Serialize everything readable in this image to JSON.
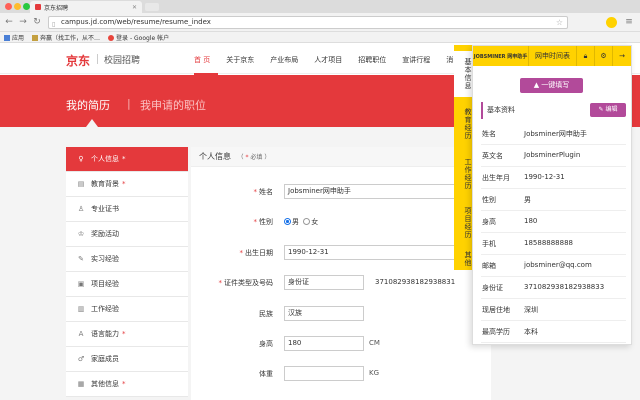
{
  "browser": {
    "tab_title": "京东招聘",
    "url": "campus.jd.com/web/resume/resume_index",
    "bookmarks": [
      "应用",
      "奔赢（找工作，从不…",
      "登录 - Google 帐户"
    ]
  },
  "header": {
    "logo": "京东",
    "sub": "校园招聘",
    "nav": [
      "首 页",
      "关于京东",
      "产业布局",
      "人才项目",
      "招聘职位",
      "宣讲行程",
      "消"
    ]
  },
  "banner": {
    "title": "我的简历",
    "separator": "|",
    "sub": "我申请的职位"
  },
  "sidemenu": [
    {
      "label": "个人信息",
      "icon": "person-icon",
      "glyph": "♀",
      "required": true,
      "active": true
    },
    {
      "label": "教育背景",
      "icon": "education-icon",
      "glyph": "▤",
      "required": true
    },
    {
      "label": "专业证书",
      "icon": "certificate-icon",
      "glyph": "♙",
      "required": false
    },
    {
      "label": "奖励活动",
      "icon": "award-icon",
      "glyph": "♔",
      "required": false
    },
    {
      "label": "实习经验",
      "icon": "internship-icon",
      "glyph": "✎",
      "required": false
    },
    {
      "label": "项目经验",
      "icon": "project-icon",
      "glyph": "▣",
      "required": false
    },
    {
      "label": "工作经验",
      "icon": "work-icon",
      "glyph": "▥",
      "required": false
    },
    {
      "label": "语言能力",
      "icon": "language-icon",
      "glyph": "A",
      "required": true
    },
    {
      "label": "家庭成员",
      "icon": "family-icon",
      "glyph": "♂",
      "required": false
    },
    {
      "label": "其他信息",
      "icon": "other-icon",
      "glyph": "▦",
      "required": true
    }
  ],
  "form": {
    "title": "个人信息",
    "required_note_star": "*",
    "required_note": "必填",
    "rows": [
      {
        "label": "姓名",
        "required": true,
        "value": "Jobsminer网申助手",
        "unit": ""
      },
      {
        "label": "性别",
        "required": true,
        "radio": [
          "男",
          "女"
        ],
        "radio_selected": "男"
      },
      {
        "label": "出生日期",
        "required": true,
        "value": "1990-12-31",
        "unit": ""
      },
      {
        "label": "证件类型及号码",
        "required": true,
        "value": "身份证",
        "value2": "371082938182938831"
      },
      {
        "label": "民族",
        "required": false,
        "value": "汉族",
        "unit": ""
      },
      {
        "label": "身高",
        "required": false,
        "value": "180",
        "unit": "CM"
      },
      {
        "label": "体重",
        "required": false,
        "value": "",
        "unit": "KG"
      }
    ]
  },
  "extension": {
    "logo": "JOBSMINER 网申助手",
    "toolbar": [
      "网申时间表"
    ],
    "side_tabs": [
      "基本信息",
      "教育经历",
      "工作经历",
      "项目经历",
      "其他"
    ],
    "fill_button": "一键填写",
    "section_title": "基本资料",
    "edit_button": "编辑",
    "fields": [
      {
        "k": "姓名",
        "v": "Jobsminer网申助手"
      },
      {
        "k": "英文名",
        "v": "JobsminerPlugin"
      },
      {
        "k": "出生年月",
        "v": "1990-12-31"
      },
      {
        "k": "性别",
        "v": "男"
      },
      {
        "k": "身高",
        "v": "180"
      },
      {
        "k": "手机",
        "v": "18588888888"
      },
      {
        "k": "邮箱",
        "v": "jobsminer@qq.com"
      },
      {
        "k": "身份证",
        "v": "371082938182938833"
      },
      {
        "k": "现居住地",
        "v": "深圳"
      },
      {
        "k": "最高学历",
        "v": "本科"
      }
    ]
  }
}
